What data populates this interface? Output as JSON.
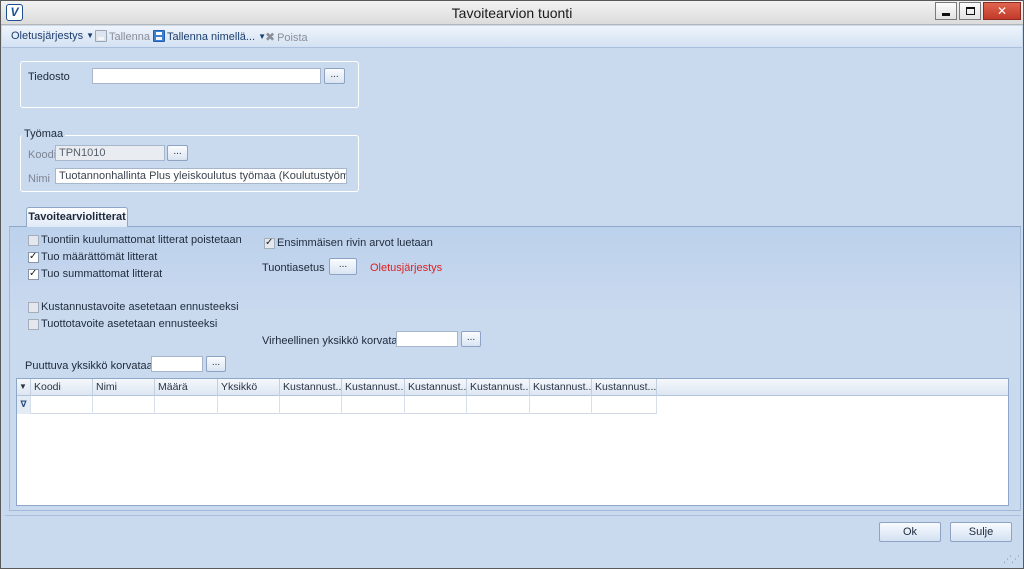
{
  "window": {
    "title": "Tavoitearvion tuonti",
    "icon": "app-logo-icon"
  },
  "toolbar": {
    "oletus": "Oletusjärjestys",
    "tallenna": "Tallenna",
    "tallenna_nimella": "Tallenna nimellä...",
    "poista": "Poista"
  },
  "file": {
    "label": "Tiedosto",
    "value": "",
    "browse": "..."
  },
  "site": {
    "group_title": "Työmaa",
    "code_label": "Koodi",
    "code_value": "TPN1010",
    "name_label": "Nimi",
    "name_value": "Tuotannonhallinta Plus yleiskoulutus työmaa (Koulutustyömaa, älä sotke)",
    "browse": "..."
  },
  "tab": {
    "label": "Tavoitearviolitterat"
  },
  "options": {
    "remove_unrelated": {
      "label": "Tuontiin kuulumattomat litterat poistetaan",
      "checked": false,
      "enabled": false
    },
    "import_no_qty": {
      "label": "Tuo määrättömät litterat",
      "checked": true,
      "enabled": true
    },
    "import_no_sum": {
      "label": "Tuo summattomat litterat",
      "checked": true,
      "enabled": true
    },
    "cost_target": {
      "label": "Kustannustavoite asetetaan ennusteeksi",
      "checked": false,
      "enabled": false
    },
    "revenue_target": {
      "label": "Tuottotavoite asetetaan ennusteeksi",
      "checked": false,
      "enabled": false
    },
    "first_row": {
      "label": "Ensimmäisen rivin arvot luetaan",
      "checked": true,
      "enabled": false
    }
  },
  "import_setting": {
    "label": "Tuontiasetus",
    "browse": "...",
    "value": "Oletusjärjestys"
  },
  "invalid_unit": {
    "label": "Virheellinen yksikkö korvataan",
    "value": "",
    "browse": "..."
  },
  "missing_unit": {
    "label": "Puuttuva yksikkö korvataan",
    "value": "",
    "browse": "..."
  },
  "grid": {
    "columns": [
      "Koodi",
      "Nimi",
      "Määrä",
      "Yksikkö",
      "Kustannust...",
      "Kustannust...",
      "Kustannust...",
      "Kustannust...",
      "Kustannust...",
      "Kustannust..."
    ],
    "rows": []
  },
  "buttons": {
    "ok": "Ok",
    "close": "Sulje"
  }
}
